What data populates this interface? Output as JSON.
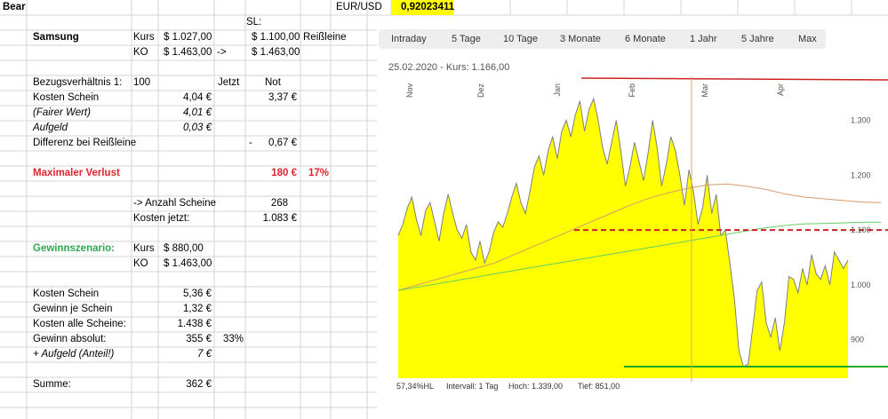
{
  "sheet": {
    "bear": "Bear",
    "eurusd_label": "EUR/USD",
    "eurusd_value": "0,92023411",
    "sl_label": "SL:",
    "samsung": "Samsung",
    "kurs": "Kurs",
    "kurs_value": "$ 1.027,00",
    "sl_value": "$ 1.100,00",
    "reissleine": "Reißleine",
    "ko": "KO",
    "ko_value": "$ 1.463,00",
    "arrow": "->",
    "ko_value2": "$ 1.463,00",
    "bezug_label": "Bezugsverhältnis 1:",
    "bezug_value": "100",
    "jetzt": "Jetzt",
    "not": "Not",
    "kosten_schein": "Kosten Schein",
    "kosten_schein_jetzt": "4,04 €",
    "kosten_schein_not": "3,37 €",
    "fairer_wert": "(Fairer Wert)",
    "fairer_wert_value": "4,01 €",
    "aufgeld": "Aufgeld",
    "aufgeld_value": "0,03 €",
    "differenz": "Differenz bei Reißleine",
    "differenz_dash": "-",
    "differenz_value": "0,67 €",
    "max_verlust": "Maximaler Verlust",
    "max_verlust_value": "180 €",
    "max_verlust_pct": "17%",
    "anzahl_label": "-> Anzahl Scheine",
    "anzahl_value": "268",
    "kosten_jetzt_label": "Kosten jetzt:",
    "kosten_jetzt_value": "1.083 €",
    "gewinnszenario": "Gewinnszenario:",
    "g_kurs": "Kurs",
    "g_kurs_value": "$ 880,00",
    "g_ko": "KO",
    "g_ko_value": "$ 1.463,00",
    "g_kosten_schein": "Kosten Schein",
    "g_kosten_schein_value": "5,36 €",
    "gewinn_je": "Gewinn je Schein",
    "gewinn_je_value": "1,32 €",
    "kosten_alle": "Kosten alle Scheine:",
    "kosten_alle_value": "1.438 €",
    "gewinn_abs": "Gewinn absolut:",
    "gewinn_abs_value": "355 €",
    "gewinn_abs_pct": "33%",
    "aufgeld_anteil": "+ Aufgeld (Anteil!)",
    "aufgeld_anteil_value": "7 €",
    "summe": "Summe:",
    "summe_value": "362 €"
  },
  "chart": {
    "tabs": [
      "Intraday",
      "5 Tage",
      "10 Tage",
      "3 Monate",
      "6 Monate",
      "1 Jahr",
      "5 Jahre",
      "Max"
    ],
    "info": "25.02.2020  -  Kurs: 1.166,00",
    "footer": {
      "hl": "57,34%HL",
      "intervall": "Intervall: 1 Tag",
      "hoch": "Hoch:  1.339,00",
      "tief": "Tief:   851,00"
    },
    "colors": {
      "area": "#ffff00",
      "line": "#7f7f7f",
      "ma_slow": "#d59a6b",
      "ma_fast": "#66cc66",
      "ko_line": "#cc2222",
      "sl_line": "#cc2222",
      "target_line": "#22aa22",
      "cursor": "#e8a05a"
    }
  },
  "chart_data": {
    "type": "area",
    "x_tick_labels": [
      "Nov",
      "Dez",
      "Jan",
      "Feb",
      "Mar",
      "Apr"
    ],
    "y_tick_labels": [
      "1.300",
      "1.200",
      "1.100",
      "1.000",
      "900"
    ],
    "ylim": [
      830,
      1380
    ],
    "grid": false,
    "series": [
      {
        "values": [
          1090,
          1110,
          1140,
          1160,
          1120,
          1090,
          1135,
          1150,
          1115,
          1080,
          1130,
          1165,
          1130,
          1100,
          1085,
          1110,
          1060,
          1045,
          1080,
          1040,
          1060,
          1095,
          1115,
          1105,
          1130,
          1160,
          1185,
          1150,
          1130,
          1170,
          1215,
          1235,
          1200,
          1245,
          1270,
          1230,
          1280,
          1300,
          1270,
          1310,
          1335,
          1280,
          1320,
          1339,
          1300,
          1250,
          1220,
          1260,
          1300,
          1245,
          1180,
          1215,
          1260,
          1225,
          1190,
          1240,
          1300,
          1250,
          1180,
          1220,
          1270,
          1245,
          1200,
          1145,
          1210,
          1170,
          1110,
          1140,
          1200,
          1130,
          1165,
          1090,
          1100,
          1040,
          975,
          880,
          851,
          855,
          920,
          990,
          1005,
          930,
          905,
          940,
          880,
          930,
          1015,
          1010,
          985,
          1030,
          1000,
          1055,
          1020,
          1010,
          1035,
          1000,
          1060,
          1045,
          1030,
          1045
        ]
      },
      {
        "values": [
          990,
          1000,
          1010,
          1020,
          1030,
          1040,
          1055,
          1070,
          1085,
          1100,
          1115,
          1130,
          1145,
          1158,
          1168,
          1176,
          1182,
          1184,
          1180,
          1174,
          1166,
          1160,
          1157,
          1154,
          1151,
          1150
        ]
      },
      {
        "values": [
          990,
          996,
          1002,
          1008,
          1014,
          1020,
          1026,
          1032,
          1038,
          1044,
          1050,
          1056,
          1062,
          1068,
          1074,
          1080,
          1086,
          1092,
          1098,
          1104,
          1108,
          1111,
          1112,
          1113,
          1114,
          1114
        ]
      }
    ],
    "reference_lines": [
      {
        "y": 1463,
        "style": "solid"
      },
      {
        "y": 1100,
        "style": "dashed"
      },
      {
        "y": 851,
        "style": "solid"
      }
    ],
    "selected": {
      "date": "25.02.2020",
      "value": 1166
    }
  }
}
